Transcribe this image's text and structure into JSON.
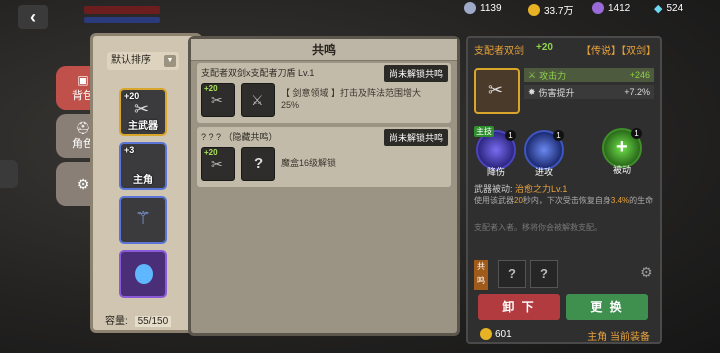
{
  "currencies": [
    {
      "name": "silver-coin-icon",
      "value": "1139",
      "color": "#9fa9c9"
    },
    {
      "name": "gold-coin-icon",
      "value": "33.7万",
      "color": "#e7b224"
    },
    {
      "name": "purple-gem-icon",
      "value": "1412",
      "color": "#9a6ad8"
    },
    {
      "name": "diamond-icon",
      "value": "524",
      "color": "#6fd8f0"
    }
  ],
  "side_tabs": [
    {
      "label": "背包",
      "active": true
    },
    {
      "label": "角色",
      "active": false
    },
    {
      "label": "",
      "active": false
    }
  ],
  "inventory": {
    "sort_label": "默认排序",
    "capacity_label": "容量:",
    "capacity_value": "55/150",
    "slots": [
      {
        "level": "+20",
        "label": "主武器"
      },
      {
        "level": "+3",
        "label": "主角"
      },
      {
        "level": "",
        "label": ""
      },
      {
        "level": "",
        "label": ""
      }
    ]
  },
  "resonance": {
    "title": "共鸣",
    "rows": [
      {
        "title": "支配者双剑x支配者刀盾 Lv.1",
        "unlock": "尚未解锁共鸣",
        "item_levels": [
          "+20",
          ""
        ],
        "desc": "【 剑意领域 】打击及阵法范围增大\n25%"
      },
      {
        "title": "? ? ? （隐藏共鸣）",
        "unlock": "尚未解锁共鸣",
        "item_levels": [
          "+20",
          ""
        ],
        "desc": "魔盒16级解锁"
      }
    ]
  },
  "detail": {
    "name": "支配者双剑",
    "level": "+20",
    "tags": "【传说】【双剑】",
    "stats": [
      {
        "label": "攻击力",
        "value": "+246"
      },
      {
        "label": "伤害提升",
        "value": "+7.2%"
      }
    ],
    "skills": [
      {
        "tag": "主技",
        "count": "1",
        "label": "降伤"
      },
      {
        "tag": "",
        "count": "1",
        "label": "进攻"
      },
      {
        "tag": "",
        "count": "1",
        "label": "被动"
      }
    ],
    "passive_title": "武器被动: ",
    "passive_name": "治愈之力Lv.1",
    "passive_desc_1": "使用该武器",
    "passive_desc_num": "20",
    "passive_desc_2": "秒内，下次受击恢复自身",
    "passive_desc_pct": "3.4%",
    "passive_desc_3": "的生命",
    "flavor": "支配者入者。移将你会被解救支配。",
    "resonance_tag": "共鸣",
    "unequip_label": "卸 下",
    "replace_label": "更 换",
    "coin_value": "601",
    "owner_label": "主角 当前装备"
  }
}
